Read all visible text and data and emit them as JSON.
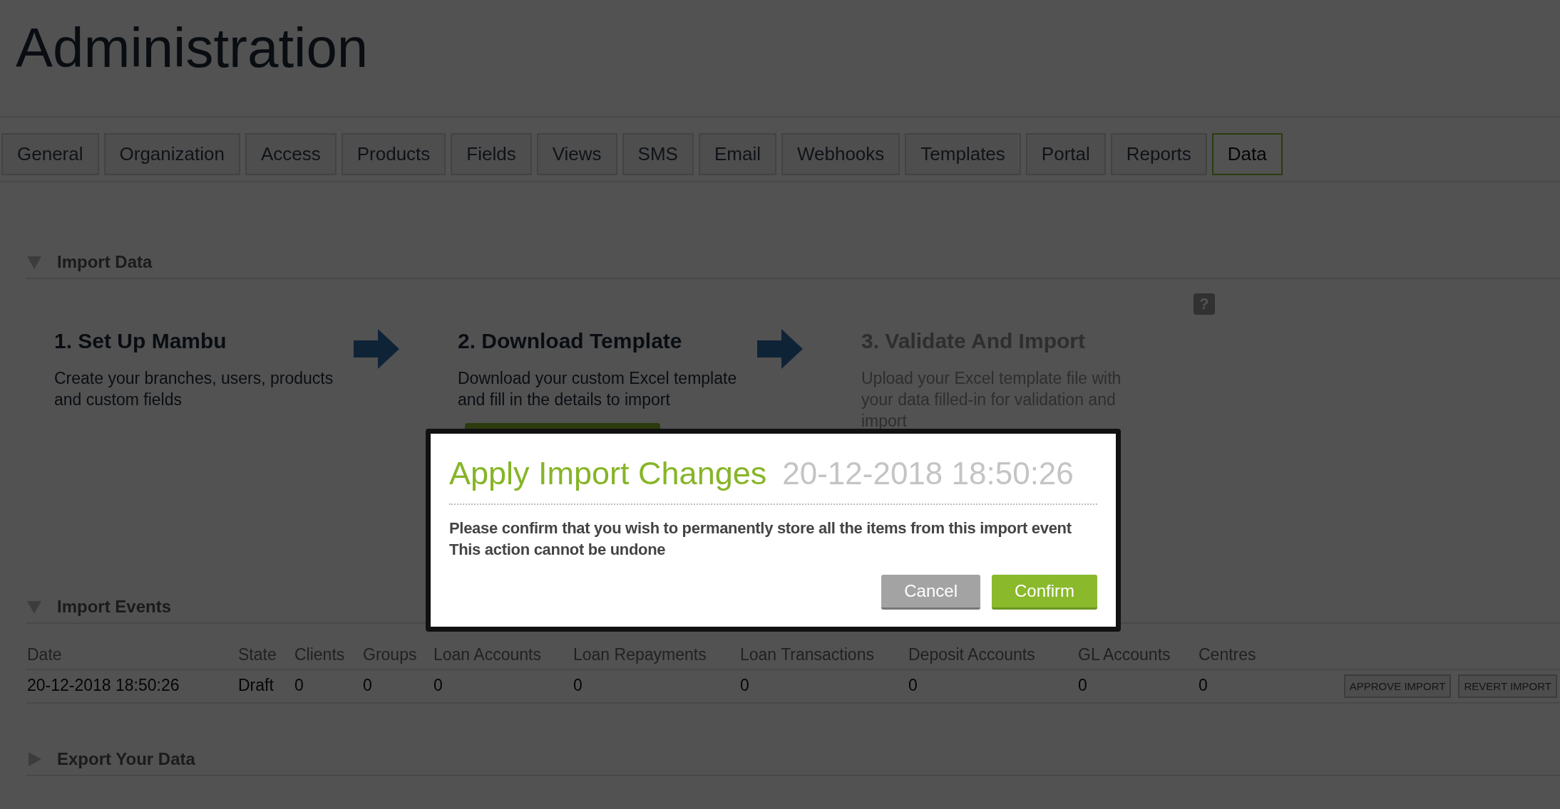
{
  "page_title": "Administration",
  "tabs": [
    {
      "label": "General",
      "selected": false
    },
    {
      "label": "Organization",
      "selected": false
    },
    {
      "label": "Access",
      "selected": false
    },
    {
      "label": "Products",
      "selected": false
    },
    {
      "label": "Fields",
      "selected": false
    },
    {
      "label": "Views",
      "selected": false
    },
    {
      "label": "SMS",
      "selected": false
    },
    {
      "label": "Email",
      "selected": false
    },
    {
      "label": "Webhooks",
      "selected": false
    },
    {
      "label": "Templates",
      "selected": false
    },
    {
      "label": "Portal",
      "selected": false
    },
    {
      "label": "Reports",
      "selected": false
    },
    {
      "label": "Data",
      "selected": true
    }
  ],
  "import_data": {
    "title": "Import Data",
    "expanded": true,
    "help_icon": "?",
    "steps": [
      {
        "title": "1. Set Up Mambu",
        "text": "Create your branches, users, products and custom fields",
        "disabled": false
      },
      {
        "title": "2. Download Template",
        "text": "Download your custom Excel template and fill in the details to import",
        "disabled": false
      },
      {
        "title": "3. Validate And Import",
        "text": "Upload your Excel template file with your data filled-in for validation and import",
        "disabled": true
      }
    ]
  },
  "import_events": {
    "title": "Import Events",
    "expanded": true,
    "columns": [
      "Date",
      "State",
      "Clients",
      "Groups",
      "Loan Accounts",
      "Loan Repayments",
      "Loan Transactions",
      "Deposit Accounts",
      "GL Accounts",
      "Centres"
    ],
    "rows": [
      {
        "cells": [
          "20-12-2018 18:50:26",
          "Draft",
          "0",
          "0",
          "0",
          "0",
          "0",
          "0",
          "0",
          "0"
        ],
        "actions": [
          "APPROVE IMPORT",
          "REVERT IMPORT"
        ]
      }
    ]
  },
  "export_data": {
    "title": "Export Your Data",
    "expanded": false
  },
  "dialog": {
    "title": "Apply Import Changes",
    "timestamp": "20-12-2018 18:50:26",
    "message": [
      "Please confirm that you wish to permanently store all the items from this import event",
      "This action cannot be undone"
    ],
    "buttons": [
      {
        "label": "Cancel",
        "kind": "secondary"
      },
      {
        "label": "Confirm",
        "kind": "primary"
      }
    ]
  }
}
